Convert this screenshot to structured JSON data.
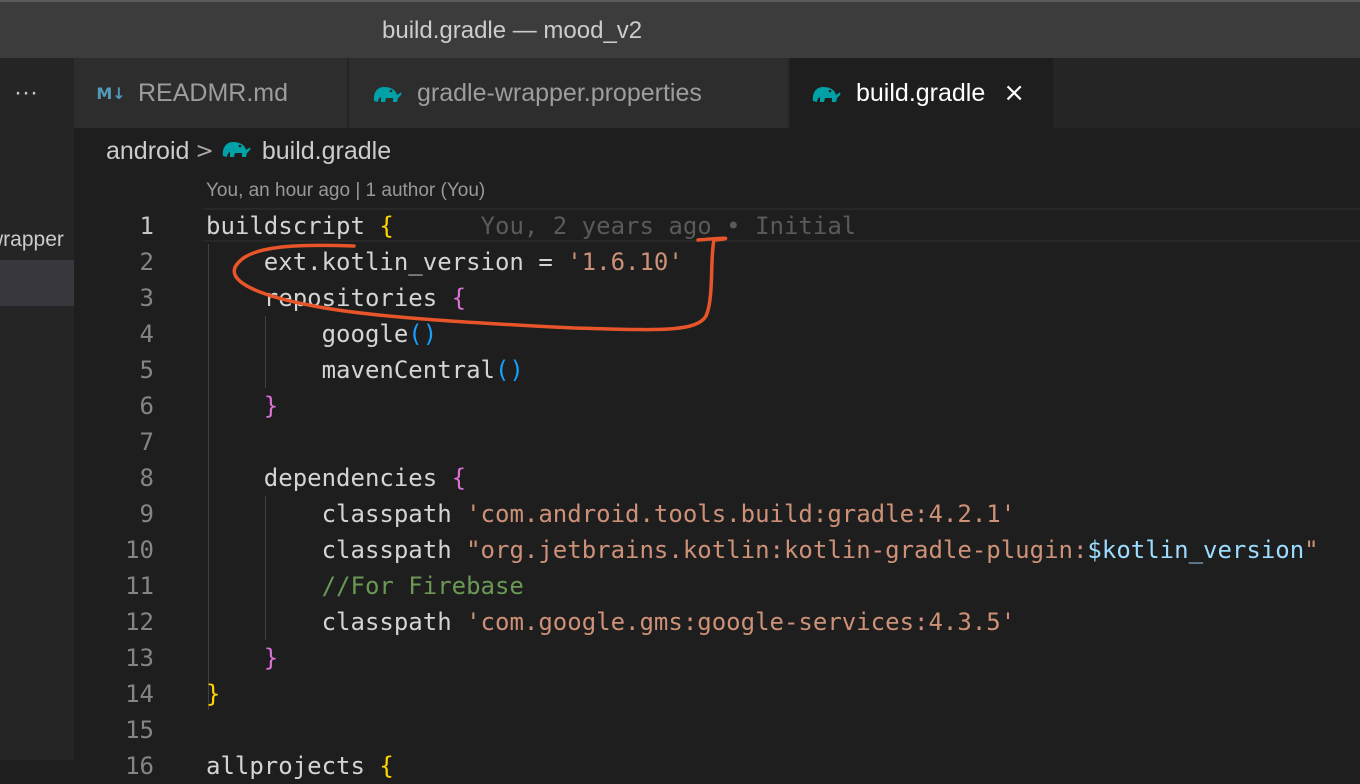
{
  "window": {
    "title": "build.gradle — mood_v2"
  },
  "sidebar": {
    "ellipsis": "···",
    "partial_item": "wrapper"
  },
  "tabs": [
    {
      "label": "READMR.md",
      "icon": "markdown-icon",
      "active": false
    },
    {
      "label": "gradle-wrapper.properties",
      "icon": "gradle-elephant-icon",
      "active": false
    },
    {
      "label": "build.gradle",
      "icon": "gradle-elephant-icon",
      "active": true,
      "close": "×"
    }
  ],
  "breadcrumb": {
    "folder": "android",
    "separator": ">",
    "file": "build.gradle"
  },
  "codelens": "You, an hour ago | 1 author (You)",
  "blame": "You, 2 years ago • Initial",
  "code": {
    "lines": [
      {
        "n": "1",
        "tokens": [
          [
            "plain",
            "buildscript "
          ],
          [
            "b1",
            "{"
          ]
        ]
      },
      {
        "n": "2",
        "tokens": [
          [
            "plain",
            "    ext.kotlin_version = "
          ],
          [
            "str",
            "'1.6.10'"
          ]
        ]
      },
      {
        "n": "3",
        "tokens": [
          [
            "plain",
            "    repositories "
          ],
          [
            "b2",
            "{"
          ]
        ]
      },
      {
        "n": "4",
        "tokens": [
          [
            "plain",
            "        google"
          ],
          [
            "b3",
            "()"
          ]
        ]
      },
      {
        "n": "5",
        "tokens": [
          [
            "plain",
            "        mavenCentral"
          ],
          [
            "b3",
            "()"
          ]
        ]
      },
      {
        "n": "6",
        "tokens": [
          [
            "b2",
            "    }"
          ]
        ]
      },
      {
        "n": "7",
        "tokens": []
      },
      {
        "n": "8",
        "tokens": [
          [
            "plain",
            "    dependencies "
          ],
          [
            "b2",
            "{"
          ]
        ]
      },
      {
        "n": "9",
        "tokens": [
          [
            "plain",
            "        classpath "
          ],
          [
            "str",
            "'com.android.tools.build:gradle:4.2.1'"
          ]
        ]
      },
      {
        "n": "10",
        "tokens": [
          [
            "plain",
            "        classpath "
          ],
          [
            "str",
            "\"org.jetbrains.kotlin:kotlin-gradle-plugin:"
          ],
          [
            "var",
            "$kotlin_version"
          ],
          [
            "str",
            "\""
          ]
        ]
      },
      {
        "n": "11",
        "tokens": [
          [
            "comment",
            "        //For Firebase"
          ]
        ]
      },
      {
        "n": "12",
        "tokens": [
          [
            "plain",
            "        classpath "
          ],
          [
            "str",
            "'com.google.gms:google-services:4.3.5'"
          ]
        ]
      },
      {
        "n": "13",
        "tokens": [
          [
            "b2",
            "    }"
          ]
        ]
      },
      {
        "n": "14",
        "tokens": [
          [
            "b1",
            "}"
          ]
        ]
      },
      {
        "n": "15",
        "tokens": []
      },
      {
        "n": "16",
        "tokens": [
          [
            "plain",
            "allprojects "
          ],
          [
            "b1",
            "{"
          ]
        ]
      }
    ]
  },
  "annotation": {
    "color": "#e8552a",
    "shape": "hand-drawn-circle"
  },
  "colors": {
    "editor_bg": "#1e1e1e",
    "string": "#ce9178",
    "variable": "#9cdcfe",
    "comment": "#6a9955",
    "bracket_level1": "#ffd700",
    "bracket_level2": "#da70d6",
    "bracket_level3": "#179fff",
    "gradle_icon": "#02a1a8"
  }
}
